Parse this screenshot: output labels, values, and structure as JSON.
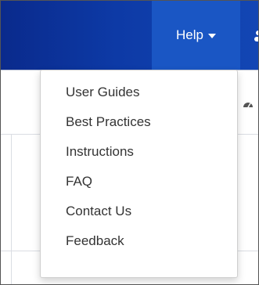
{
  "navbar": {
    "help_label": "Help",
    "colors": {
      "bar": "#0d3aa6",
      "active": "#1a56c4",
      "text": "#ffffff"
    }
  },
  "help_menu": {
    "items": [
      {
        "label": "User Guides"
      },
      {
        "label": "Best Practices"
      },
      {
        "label": "Instructions"
      },
      {
        "label": "FAQ"
      },
      {
        "label": "Contact Us"
      },
      {
        "label": "Feedback"
      }
    ],
    "text_color": "#333333"
  },
  "icons": {
    "caret": "caret-down-icon",
    "dashboard": "dashboard-icon",
    "user": "user-icon"
  }
}
